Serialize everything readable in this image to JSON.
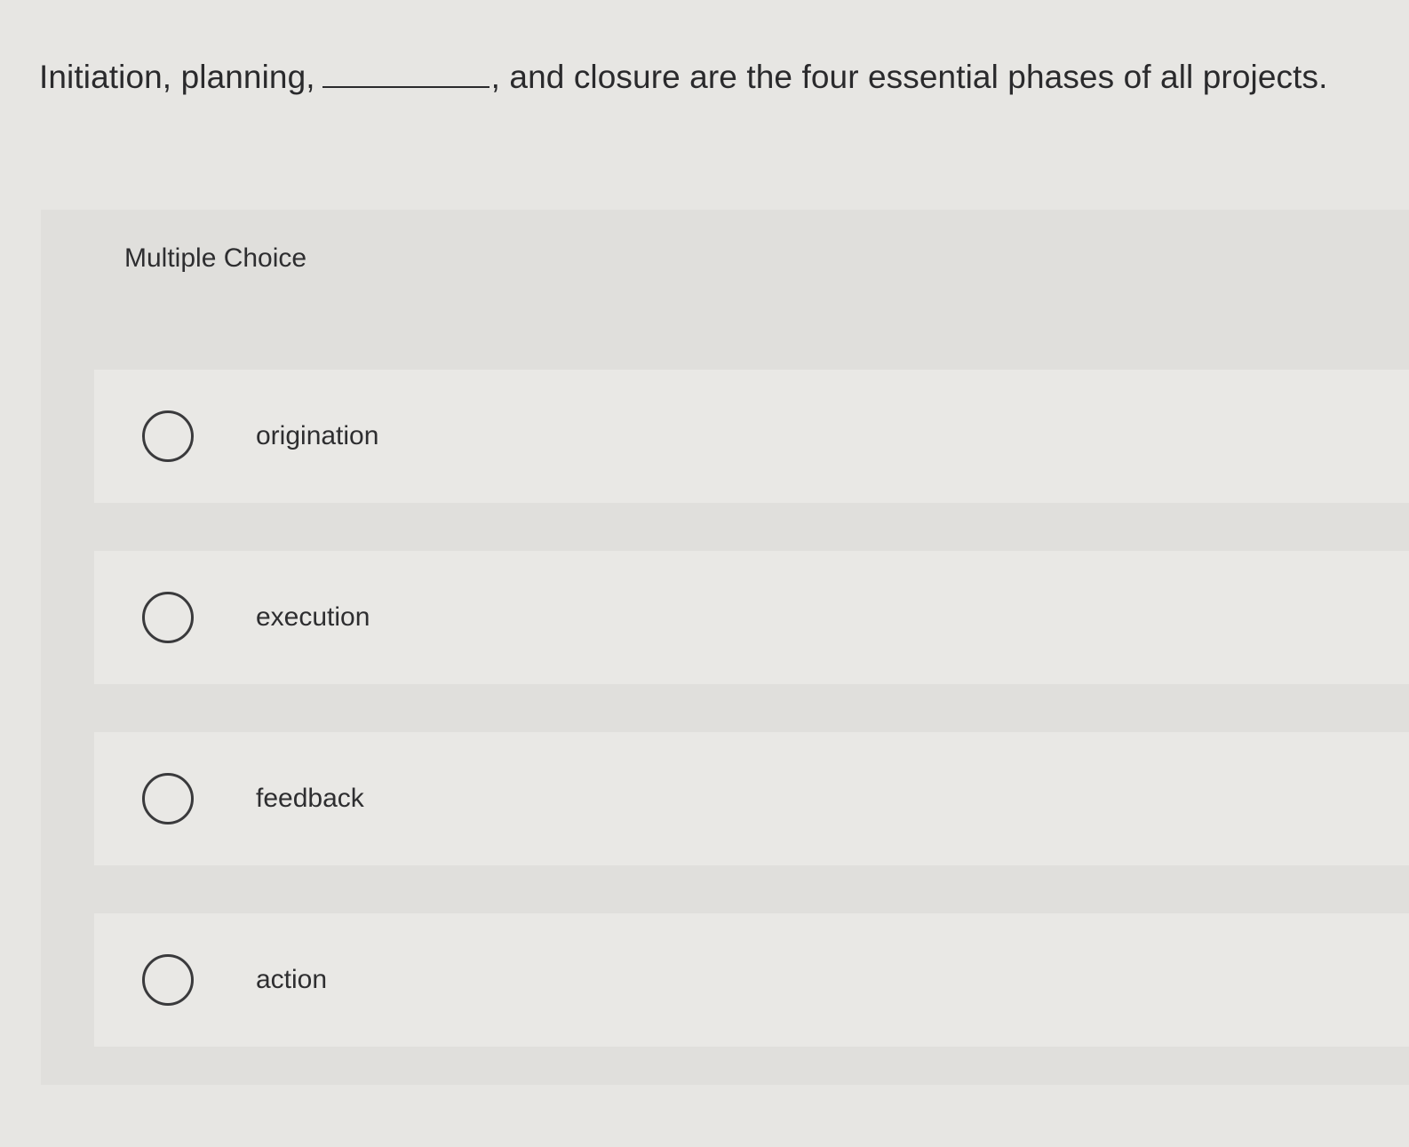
{
  "question": {
    "before_blank": "Initiation, planning,",
    "after_blank": ", and closure are the four essential phases of all projects."
  },
  "panel": {
    "heading": "Multiple Choice"
  },
  "choices": [
    {
      "label": "origination"
    },
    {
      "label": "execution"
    },
    {
      "label": "feedback"
    },
    {
      "label": "action"
    }
  ]
}
